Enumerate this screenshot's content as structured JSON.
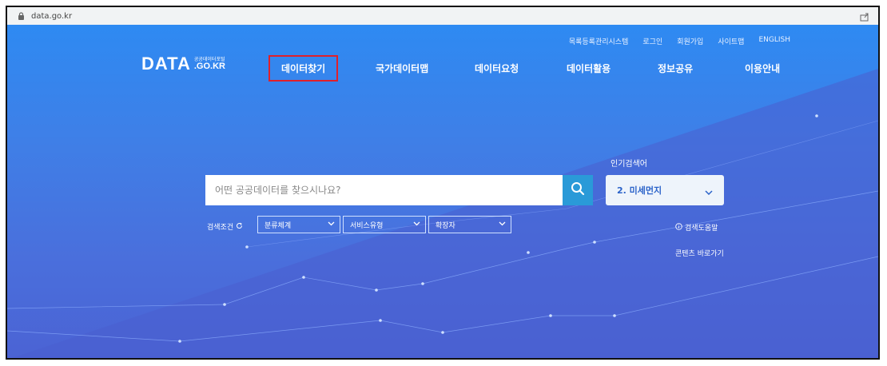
{
  "browser": {
    "url": "data.go.kr"
  },
  "site": {
    "logo": {
      "main": "DATA",
      "small": "공공데이터포털",
      "sub": ".GO.KR"
    },
    "utility_links": [
      "목록등록관리시스템",
      "로그인",
      "회원가입",
      "사이트맵",
      "ENGLISH"
    ],
    "nav": [
      {
        "label": "데이터찾기",
        "active": true
      },
      {
        "label": "국가데이터맵",
        "active": false
      },
      {
        "label": "데이터요청",
        "active": false
      },
      {
        "label": "데이터활용",
        "active": false
      },
      {
        "label": "정보공유",
        "active": false
      },
      {
        "label": "이용안내",
        "active": false
      }
    ],
    "colors": {
      "hero_top": "#2e8af2",
      "hero_bottom": "#4b63d4",
      "search_button": "#2a9ad8",
      "active_outline": "#e0202a"
    }
  },
  "search": {
    "placeholder": "어떤 공공데이터를 찾으시나요?",
    "value": "",
    "button_icon": "search-icon"
  },
  "popular": {
    "label": "인기검색어",
    "selected": "2. 미세먼지"
  },
  "filters": {
    "label": "검색조건",
    "selects": [
      {
        "label": "분류체계"
      },
      {
        "label": "서비스유형"
      },
      {
        "label": "확장자"
      }
    ]
  },
  "links": {
    "help": "검색도움말",
    "shortcut": "콘텐츠 바로가기"
  }
}
